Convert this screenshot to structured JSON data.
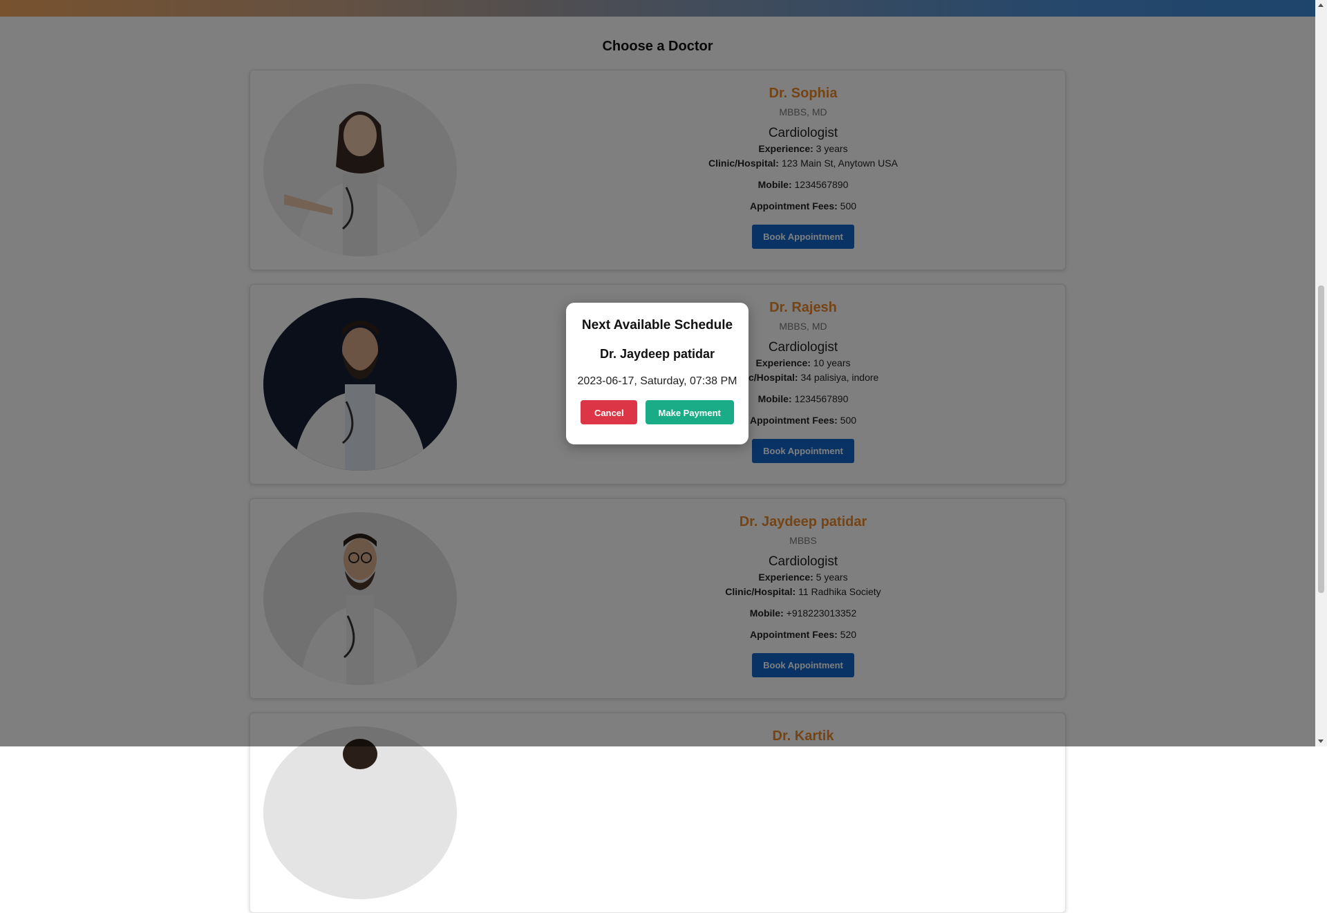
{
  "page": {
    "title": "Choose a Doctor"
  },
  "labels": {
    "experience": "Experience:",
    "clinic": "Clinic/Hospital:",
    "mobile": "Mobile:",
    "fees": "Appointment Fees:",
    "book": "Book Appointment"
  },
  "doctors": [
    {
      "name": "Dr. Sophia",
      "degree": "MBBS, MD",
      "specialty": "Cardiologist",
      "experience": "3 years",
      "clinic": "123 Main St, Anytown USA",
      "mobile": "1234567890",
      "fees": "500"
    },
    {
      "name": "Dr. Rajesh",
      "degree": "MBBS, MD",
      "specialty": "Cardiologist",
      "experience": "10 years",
      "clinic": "34 palisiya, indore",
      "mobile": "1234567890",
      "fees": "500"
    },
    {
      "name": "Dr. Jaydeep patidar",
      "degree": "MBBS",
      "specialty": "Cardiologist",
      "experience": "5 years",
      "clinic": "11 Radhika Society",
      "mobile": "+918223013352",
      "fees": "520"
    },
    {
      "name": "Dr. Kartik"
    }
  ],
  "modal": {
    "title": "Next Available Schedule",
    "doctor": "Dr. Jaydeep patidar",
    "datetime": "2023-06-17, Saturday, 07:38 PM",
    "cancel": "Cancel",
    "pay": "Make Payment"
  },
  "colors": {
    "name_accent": "#e8892b",
    "book_button": "#1166c8",
    "cancel_button": "#dc3545",
    "pay_button": "#1aac86"
  }
}
